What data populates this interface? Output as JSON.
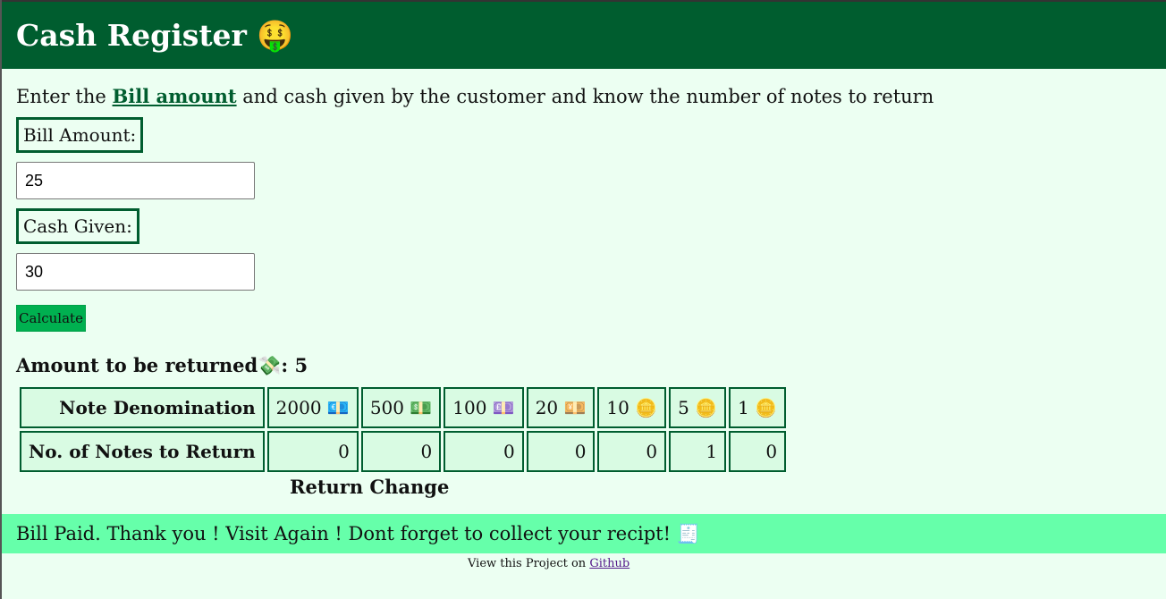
{
  "header": {
    "title": "Cash Register 🤑"
  },
  "intro": {
    "prefix": "Enter the ",
    "link_text": "Bill amount",
    "suffix": " and cash given by the customer and know the number of notes to return"
  },
  "form": {
    "bill_label": "Bill Amount:",
    "bill_value": "25",
    "cash_label": "Cash Given:",
    "cash_value": "30",
    "calculate_label": "Calculate"
  },
  "result": {
    "label": "Amount to be returned💸:",
    "amount": "5"
  },
  "table": {
    "denomination_header": "Note Denomination",
    "count_header": "No. of Notes to Return",
    "denominations": [
      "2000 💶",
      "500 💵",
      "100 💷",
      "20 💴",
      "10 🪙",
      "5 🪙",
      "1 🪙"
    ],
    "counts": [
      "0",
      "0",
      "0",
      "0",
      "0",
      "1",
      "0"
    ],
    "caption": "Return Change"
  },
  "message": {
    "text": "Bill Paid. Thank you ! Visit Again ! Dont forget to collect your recipt! 🧾"
  },
  "footer": {
    "prefix": "View this Project on ",
    "link_text": "Github"
  },
  "colors": {
    "header_bg": "#005d2f",
    "page_bg": "#ecfff2",
    "button_bg": "#00b050",
    "message_bg": "#66ffaa"
  }
}
